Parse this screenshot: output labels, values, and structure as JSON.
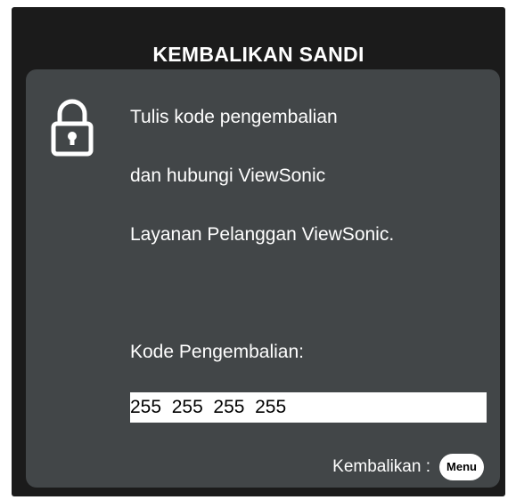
{
  "dialog": {
    "title": "KEMBALIKAN SANDI",
    "icon": "lock-icon",
    "message_lines": [
      "Tulis kode pengembalian",
      "dan hubungi ViewSonic",
      "Layanan Pelanggan ViewSonic."
    ],
    "code_label": "Kode Pengembalian:",
    "code_value": "255  255  255  255",
    "back_label": "Kembalikan :",
    "menu_button_label": "Menu"
  },
  "colors": {
    "frame": "#1b1b1b",
    "panel": "#424648",
    "text": "#ffffff",
    "field": "#ffffff"
  }
}
